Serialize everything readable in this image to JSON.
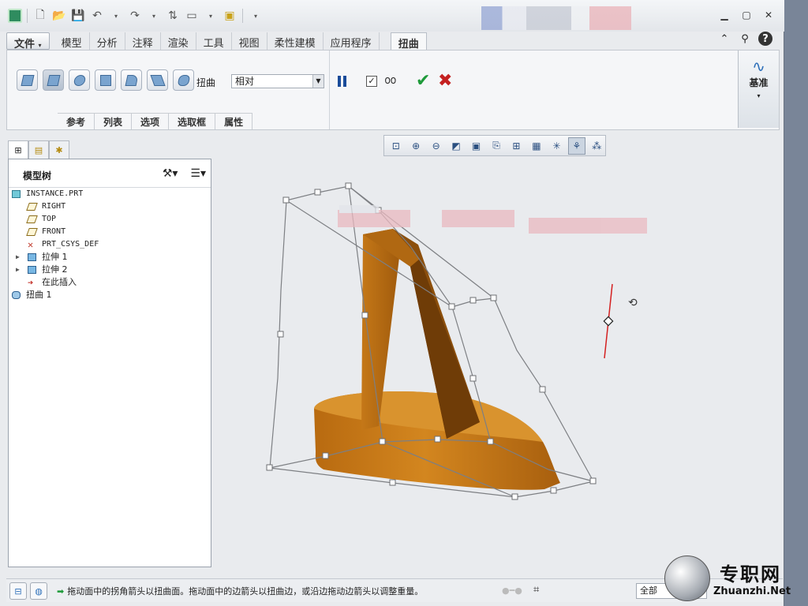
{
  "ribbon_tabs": [
    "文件",
    "模型",
    "分析",
    "注释",
    "渲染",
    "工具",
    "视图",
    "柔性建模",
    "应用程序",
    "扭曲"
  ],
  "file_tab_arrow": "▾",
  "ribbon": {
    "warp_label": "扭曲",
    "mode_value": "相对",
    "subtabs": [
      "参考",
      "列表",
      "选项",
      "选取框",
      "属性"
    ],
    "datum_label": "基准",
    "datum_arrow": "▾"
  },
  "model_tree": {
    "title": "模型树",
    "nodes": [
      {
        "label": "INSTANCE.PRT",
        "icon": "part-icon",
        "expandable": false,
        "indent": 0
      },
      {
        "label": "RIGHT",
        "icon": "datum-plane-icon",
        "expandable": false,
        "indent": 1
      },
      {
        "label": "TOP",
        "icon": "datum-plane-icon",
        "expandable": false,
        "indent": 1
      },
      {
        "label": "FRONT",
        "icon": "datum-plane-icon",
        "expandable": false,
        "indent": 1
      },
      {
        "label": "PRT_CSYS_DEF",
        "icon": "csys-icon",
        "expandable": false,
        "indent": 1
      },
      {
        "label": "拉伸 1",
        "icon": "extrude-icon",
        "expandable": true,
        "indent": 1
      },
      {
        "label": "拉伸 2",
        "icon": "extrude-icon",
        "expandable": true,
        "indent": 1
      },
      {
        "label": "在此插入",
        "icon": "insert-here-icon",
        "expandable": false,
        "indent": 1
      },
      {
        "label": "扭曲 1",
        "icon": "warp-feature-icon",
        "expandable": false,
        "indent": 0
      }
    ]
  },
  "status": {
    "message": "拖动面中的拐角箭头以扭曲面。拖动面中的边箭头以扭曲边，或沿边拖动边箭头以调整重量。",
    "filter_value": "全部"
  },
  "watermark": {
    "cn": "专职网",
    "en": "Zhuanzhi.Net"
  },
  "colors": {
    "model_fill": "#c9771a",
    "model_dark": "#8a4e0c",
    "cage_line": "#7d7f83",
    "axis_red": "#d42020",
    "ok_green": "#1e9a3a",
    "cancel_red": "#c42020"
  }
}
